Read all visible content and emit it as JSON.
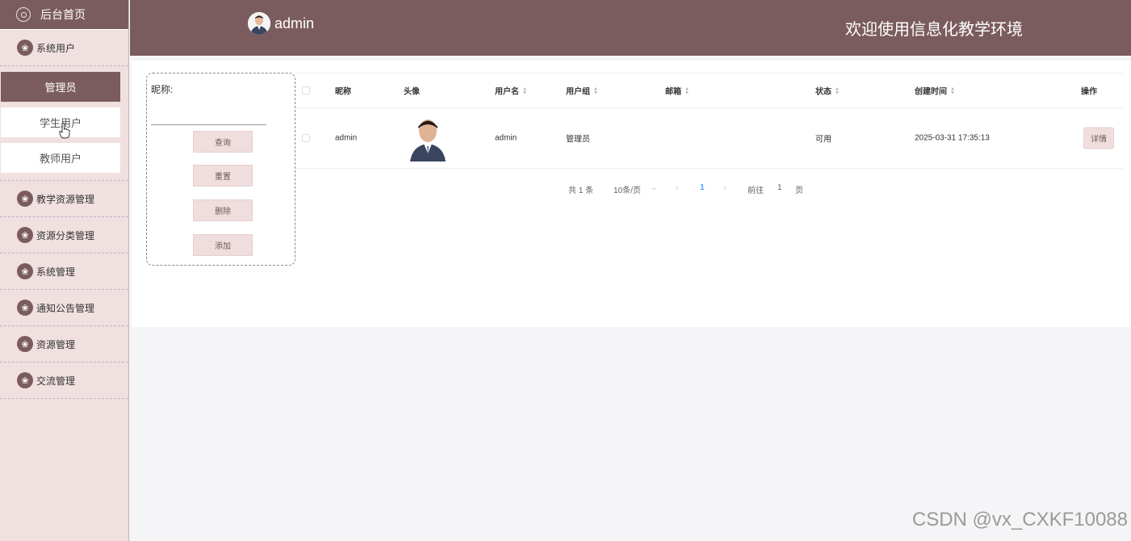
{
  "sidebar": {
    "home": "后台首页",
    "system_users": "系统用户",
    "sub_items": [
      "管理员",
      "学生用户",
      "教师用户"
    ],
    "menus": [
      "教学资源管理",
      "资源分类管理",
      "系统管理",
      "通知公告管理",
      "资源管理",
      "交流管理"
    ]
  },
  "header": {
    "username": "admin",
    "title": "欢迎使用信息化教学环境"
  },
  "search": {
    "label": "昵称:",
    "input_value": "",
    "buttons": [
      "查询",
      "重置",
      "删除",
      "添加"
    ]
  },
  "table": {
    "columns": [
      "昵称",
      "头像",
      "用户名",
      "用户组",
      "邮箱",
      "状态",
      "创建时间",
      "操作"
    ],
    "rows": [
      {
        "nickname": "admin",
        "username": "admin",
        "group": "管理员",
        "email": "",
        "status": "可用",
        "created": "2025-03-31 17:35:13",
        "action": "详情"
      }
    ]
  },
  "pagination": {
    "total": "共 1 条",
    "page_size": "10条/页",
    "current_page": "1",
    "goto_label": "前往",
    "goto_value": "1",
    "page_suffix": "页"
  },
  "watermark": "CSDN @vx_CXKF10088",
  "colors": {
    "primary": "#7b5c5e",
    "sidebar_bg": "#f0e0e0",
    "button_bg": "#f0dede",
    "accent": "#409eff"
  }
}
